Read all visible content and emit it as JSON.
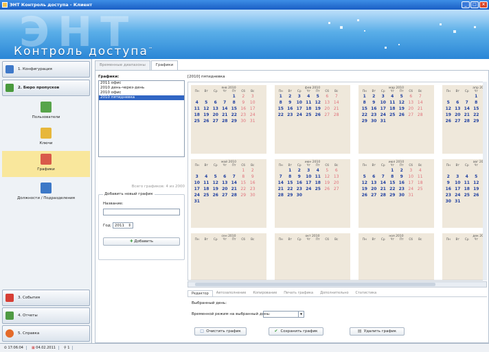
{
  "window": {
    "title": "ЭНТ Контроль доступа - Клиент"
  },
  "banner": {
    "bg_text": "ЭНТ",
    "logo": "Контроль доступа",
    "tm": "™"
  },
  "nav": {
    "top": [
      {
        "label": "1. Конфигурация",
        "color": "#3f79c9"
      },
      {
        "label": "2. Бюро пропусков",
        "color": "#4a9a3d"
      }
    ],
    "subitems": [
      {
        "label": "Пользователи",
        "color": "#57a44a"
      },
      {
        "label": "Ключи",
        "color": "#e7b73b"
      },
      {
        "label": "Графики",
        "color": "#d95a4a"
      },
      {
        "label": "Должности / Подразделения",
        "color": "#3c78c7"
      }
    ],
    "bottom": [
      {
        "label": "3. События",
        "color": "#d63f35"
      },
      {
        "label": "4. Отчеты",
        "color": "#4f9a43"
      },
      {
        "label": "5. Справка",
        "color": "#e46b2a"
      }
    ]
  },
  "tabs": [
    "Временные диапазоны",
    "Графики"
  ],
  "schedules": {
    "label": "Графики:",
    "items": [
      "2011 офис",
      "2010 день-через-день",
      "2010 офис",
      "2010 пятидневка"
    ],
    "selected": 3,
    "hint": "Всего графиков: 4 из 2000"
  },
  "add_new": {
    "legend": "Добавить новый график",
    "name_label": "Название:",
    "name_value": "",
    "year_label": "Год:",
    "year_value": "2011",
    "button": "Добавить"
  },
  "calendar": {
    "title": "[2010] пятидневка",
    "weekday_header": [
      "Пн",
      "Вт",
      "Ср",
      "Чт",
      "Пт",
      "Сб",
      "Вс"
    ],
    "months": [
      {
        "name": "янв 2010",
        "weeks": [
          [
            "",
            "",
            "",
            "",
            "1",
            "2",
            "3"
          ],
          [
            "4",
            "5",
            "6",
            "7",
            "8",
            "9",
            "10"
          ],
          [
            "11",
            "12",
            "13",
            "14",
            "15",
            "16",
            "17"
          ],
          [
            "18",
            "19",
            "20",
            "21",
            "22",
            "23",
            "24"
          ],
          [
            "25",
            "26",
            "27",
            "28",
            "29",
            "30",
            "31"
          ]
        ]
      },
      {
        "name": "фев 2010",
        "weeks": [
          [
            "1",
            "2",
            "3",
            "4",
            "5",
            "6",
            "7"
          ],
          [
            "8",
            "9",
            "10",
            "11",
            "12",
            "13",
            "14"
          ],
          [
            "15",
            "16",
            "17",
            "18",
            "19",
            "20",
            "21"
          ],
          [
            "22",
            "23",
            "24",
            "25",
            "26",
            "27",
            "28"
          ]
        ]
      },
      {
        "name": "мар 2010",
        "weeks": [
          [
            "1",
            "2",
            "3",
            "4",
            "5",
            "6",
            "7"
          ],
          [
            "8",
            "9",
            "10",
            "11",
            "12",
            "13",
            "14"
          ],
          [
            "15",
            "16",
            "17",
            "18",
            "19",
            "20",
            "21"
          ],
          [
            "22",
            "23",
            "24",
            "25",
            "26",
            "27",
            "28"
          ],
          [
            "29",
            "30",
            "31",
            "",
            "",
            "",
            ""
          ]
        ]
      },
      {
        "name": "апр 2010",
        "weeks": [
          [
            "",
            "",
            "",
            "1",
            "2",
            "3",
            "4"
          ],
          [
            "5",
            "6",
            "7",
            "8",
            "9",
            "10",
            "11"
          ],
          [
            "12",
            "13",
            "14",
            "15",
            "16",
            "17",
            "18"
          ],
          [
            "19",
            "20",
            "21",
            "22",
            "23",
            "24",
            "25"
          ],
          [
            "26",
            "27",
            "28",
            "29",
            "30",
            "",
            ""
          ]
        ]
      },
      {
        "name": "май 2010",
        "weeks": [
          [
            "",
            "",
            "",
            "",
            "",
            "1",
            "2"
          ],
          [
            "3",
            "4",
            "5",
            "6",
            "7",
            "8",
            "9"
          ],
          [
            "10",
            "11",
            "12",
            "13",
            "14",
            "15",
            "16"
          ],
          [
            "17",
            "18",
            "19",
            "20",
            "21",
            "22",
            "23"
          ],
          [
            "24",
            "25",
            "26",
            "27",
            "28",
            "29",
            "30"
          ],
          [
            "31",
            "",
            "",
            "",
            "",
            "",
            ""
          ]
        ]
      },
      {
        "name": "июн 2010",
        "weeks": [
          [
            "",
            "1",
            "2",
            "3",
            "4",
            "5",
            "6"
          ],
          [
            "7",
            "8",
            "9",
            "10",
            "11",
            "12",
            "13"
          ],
          [
            "14",
            "15",
            "16",
            "17",
            "18",
            "19",
            "20"
          ],
          [
            "21",
            "22",
            "23",
            "24",
            "25",
            "26",
            "27"
          ],
          [
            "28",
            "29",
            "30",
            "",
            "",
            "",
            ""
          ]
        ]
      },
      {
        "name": "июл 2010",
        "weeks": [
          [
            "",
            "",
            "",
            "1",
            "2",
            "3",
            "4"
          ],
          [
            "5",
            "6",
            "7",
            "8",
            "9",
            "10",
            "11"
          ],
          [
            "12",
            "13",
            "14",
            "15",
            "16",
            "17",
            "18"
          ],
          [
            "19",
            "20",
            "21",
            "22",
            "23",
            "24",
            "25"
          ],
          [
            "26",
            "27",
            "28",
            "29",
            "30",
            "31",
            ""
          ]
        ]
      },
      {
        "name": "авг 2010",
        "weeks": [
          [
            "",
            "",
            "",
            "",
            "",
            "",
            "1"
          ],
          [
            "2",
            "3",
            "4",
            "5",
            "6",
            "7",
            "8"
          ],
          [
            "9",
            "10",
            "11",
            "12",
            "13",
            "14",
            "15"
          ],
          [
            "16",
            "17",
            "18",
            "19",
            "20",
            "21",
            "22"
          ],
          [
            "23",
            "24",
            "25",
            "26",
            "27",
            "28",
            "29"
          ],
          [
            "30",
            "31",
            "",
            "",
            "",
            "",
            ""
          ]
        ]
      },
      {
        "name": "сен 2010",
        "weeks": []
      },
      {
        "name": "окт 2010",
        "weeks": []
      },
      {
        "name": "ноя 2010",
        "weeks": []
      },
      {
        "name": "дек 2010",
        "weeks": []
      }
    ]
  },
  "bottom_tabs": [
    "Редактор",
    "Автозаполнение",
    "Копирование",
    "Печать графика",
    "Дополнительно",
    "Статистика"
  ],
  "editor": {
    "selected_day_label": "Выбранный день:",
    "time_label": "Временной режим на выбранный день:",
    "time_value": "",
    "buttons": [
      "Очистить график",
      "Сохранить график",
      "Удалить график"
    ]
  },
  "statusbar": {
    "time": "17:06:04",
    "date": "04.02.2011",
    "users": "1"
  }
}
